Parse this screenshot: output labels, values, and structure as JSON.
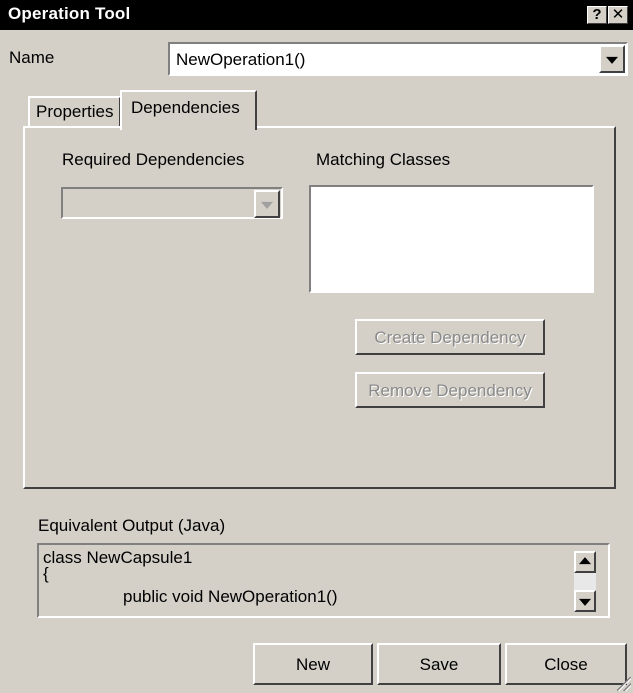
{
  "window": {
    "title": "Operation Tool",
    "help_glyph": "?",
    "close_glyph": "✕"
  },
  "name_row": {
    "label": "Name",
    "value": "NewOperation1()"
  },
  "tabs": [
    {
      "label": "Properties",
      "active": false
    },
    {
      "label": "Dependencies",
      "active": true
    }
  ],
  "dependencies": {
    "required_label": "Required Dependencies",
    "required_value": "",
    "matching_label": "Matching Classes",
    "matching_items": [],
    "create_button": "Create Dependency",
    "remove_button": "Remove Dependency"
  },
  "output": {
    "label": "Equivalent Output (Java)",
    "lines": [
      "class NewCapsule1",
      "{",
      "public void NewOperation1()"
    ]
  },
  "buttons": {
    "new": "New",
    "save": "Save",
    "close": "Close"
  },
  "colors": {
    "face": "#d4d0c8",
    "title_bar": "#000000",
    "disabled_text": "#8a8a8a"
  }
}
